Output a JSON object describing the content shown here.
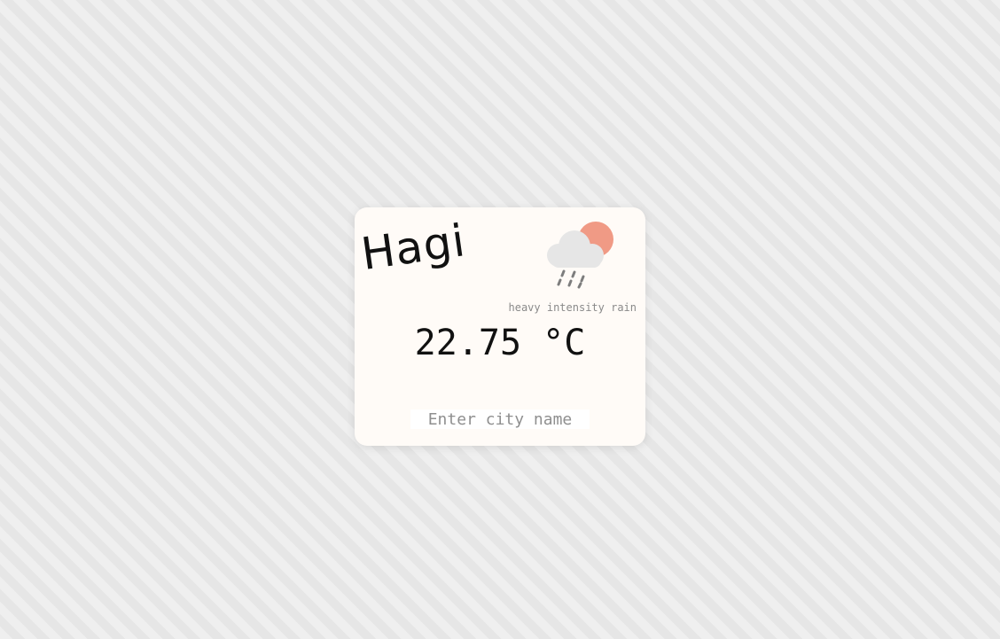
{
  "weather": {
    "city": "Hagi",
    "description": "heavy intensity rain",
    "temperature": "22.75 °C",
    "icon": "rain-cloud-sun-icon"
  },
  "search": {
    "placeholder": "Enter city name",
    "value": ""
  },
  "colors": {
    "card_background": "#fffbf7",
    "sun": "#f09a85",
    "cloud": "#e6e6e6",
    "rain_drops": "#7d7d7d",
    "text_primary": "#111111",
    "text_secondary": "#8a8a8a"
  }
}
